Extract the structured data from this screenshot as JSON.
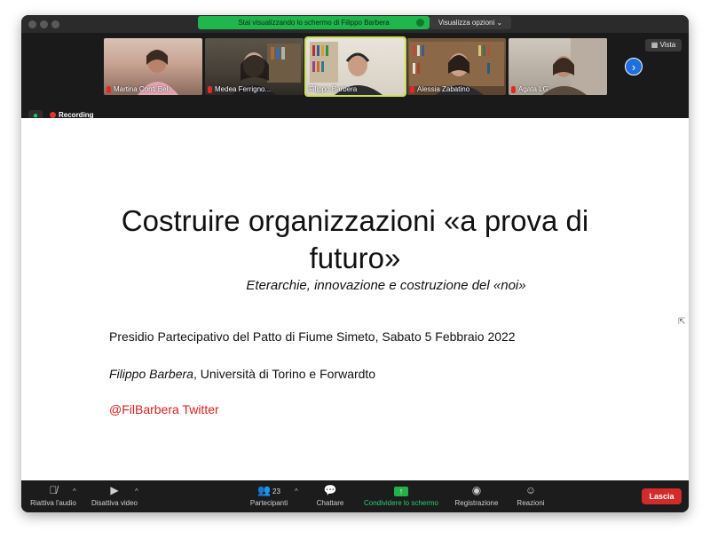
{
  "banner": {
    "sharing_text": "Stai visualizzando lo schermo di Filippo Barbera",
    "view_options": "Visualizza opzioni ⌄"
  },
  "view_button": "Vista",
  "participants_tiles": [
    {
      "name": "Martina Conti Bel...",
      "muted": true
    },
    {
      "name": "Medea Ferrigno...",
      "muted": true
    },
    {
      "name": "Filippo Barbera",
      "muted": false,
      "active": true
    },
    {
      "name": "Alessia Zabatino",
      "muted": true
    },
    {
      "name": "Agata LG",
      "muted": true
    }
  ],
  "recording_label": "Recording",
  "slide": {
    "title": "Costruire organizzazioni «a prova di futuro»",
    "subtitle": "Eterarchie, innovazione e costruzione del «noi»",
    "line1": "Presidio Partecipativo del Patto di Fiume Simeto, Sabato 5 Febbraio 2022",
    "line2_name": "Filippo Barbera",
    "line2_rest": ", Università di Torino e Forwardto",
    "line3": "@FilBarbera Twitter"
  },
  "toolbar": {
    "audio": "Riattiva l'audio",
    "video": "Disattiva video",
    "participants": "Partecipanti",
    "participants_count": "23",
    "chat": "Chattare",
    "share": "Condividere lo schermo",
    "record": "Registrazione",
    "reactions": "Reazioni",
    "leave": "Lascia"
  },
  "colors": {
    "share_green": "#1fb64c",
    "leave_red": "#d12b2b",
    "twitter_red": "#d62020",
    "active_tile": "#c8e05a"
  }
}
